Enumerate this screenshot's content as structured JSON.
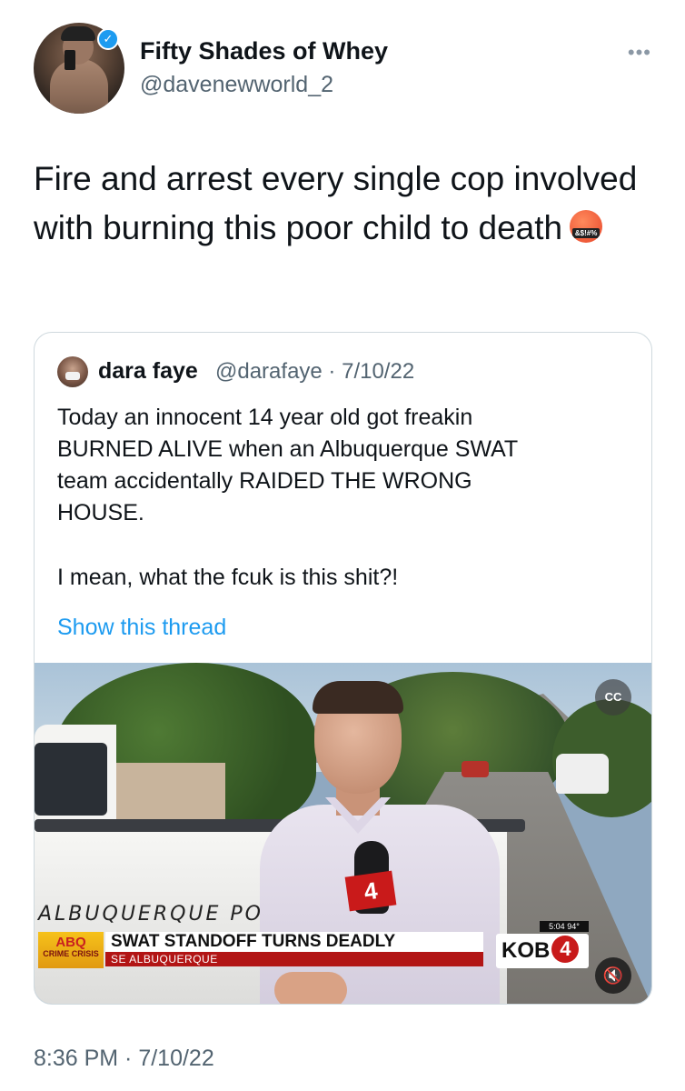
{
  "author": {
    "display_name": "Fifty Shades of Whey",
    "handle": "@davenewworld_2",
    "verified": true,
    "more_icon": "more-horizontal-icon"
  },
  "tweet": {
    "text": "Fire and arrest every single cop involved with burning this poor child to death",
    "emoji": "face-with-symbols-on-mouth",
    "emoji_symbols": "&$!#%",
    "timestamp": "8:36 PM · 7/10/22"
  },
  "quoted_tweet": {
    "display_name": "dara faye",
    "meta": "@darafaye · 7/10/22",
    "paragraph_lines": [
      "Today an innocent 14 year old got freakin",
      "BURNED ALIVE when an Albuquerque SWAT",
      "team accidentally RAIDED THE WRONG",
      "HOUSE."
    ],
    "second_paragraph": "I mean, what the fcuk is this shit?!",
    "show_thread": "Show this thread",
    "video": {
      "truck_text": "ALBUQUERQUE PO",
      "mic_flag": "4",
      "lower_third_logo_top": "ABQ",
      "lower_third_logo_bottom": "CRIME CRISIS",
      "headline": "SWAT STANDOFF TURNS DEADLY",
      "subheadline": "SE ALBUQUERQUE",
      "time_temp": "5:04  94°",
      "station": "KOB",
      "station_number": "4",
      "cc_icon_label": "CC",
      "mute_icon": "volume-mute-icon"
    }
  }
}
